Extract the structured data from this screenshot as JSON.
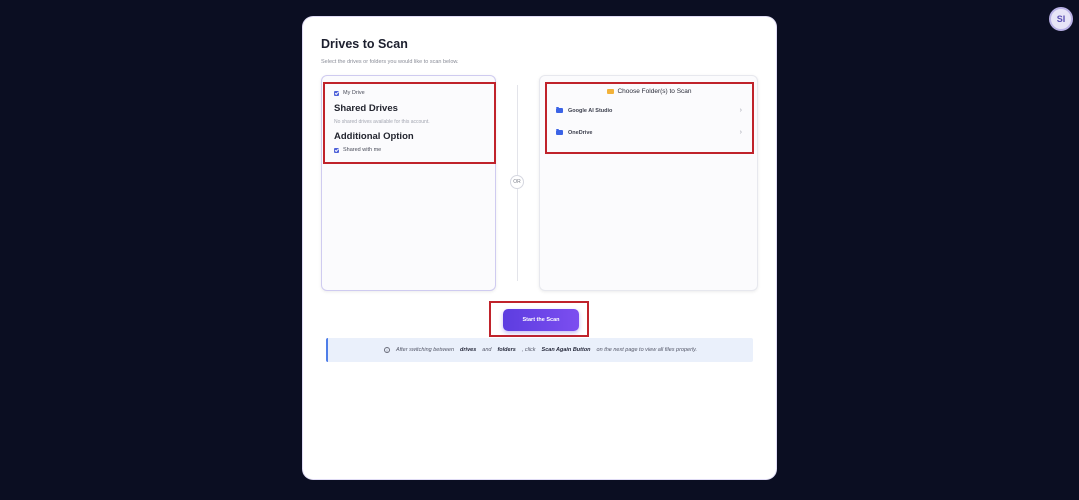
{
  "user": {
    "avatar_initials": "SI"
  },
  "page": {
    "title": "Drives to Scan",
    "subtitle": "Select the drives or folders you would like to scan below."
  },
  "drives_panel": {
    "my_drive_label": "My Drive",
    "my_drive_checked": true,
    "shared_heading": "Shared Drives",
    "shared_note": "No shared drives available for this account.",
    "additional_heading": "Additional Option",
    "shared_with_me_label": "Shared with me",
    "shared_with_me_checked": true
  },
  "or_label": "OR",
  "folders_panel": {
    "heading": "Choose Folder(s) to Scan",
    "folders": [
      {
        "name": "Google AI Studio",
        "chevron": "›"
      },
      {
        "name": "OneDrive",
        "chevron": "›"
      }
    ]
  },
  "scan_button_label": "Start the Scan",
  "info": {
    "icon": "info-icon",
    "text_1": "After switching between",
    "bold_1": "drives",
    "text_2": "and",
    "bold_2": "folders",
    "text_3": ", click",
    "bold_3": "Scan Again Button",
    "text_4": "on the next page to view all files properly."
  },
  "colors": {
    "background": "#0b0e22",
    "accent": "#6a45e8",
    "highlight": "#c0232b",
    "folder_icon": "#3b63e6"
  }
}
